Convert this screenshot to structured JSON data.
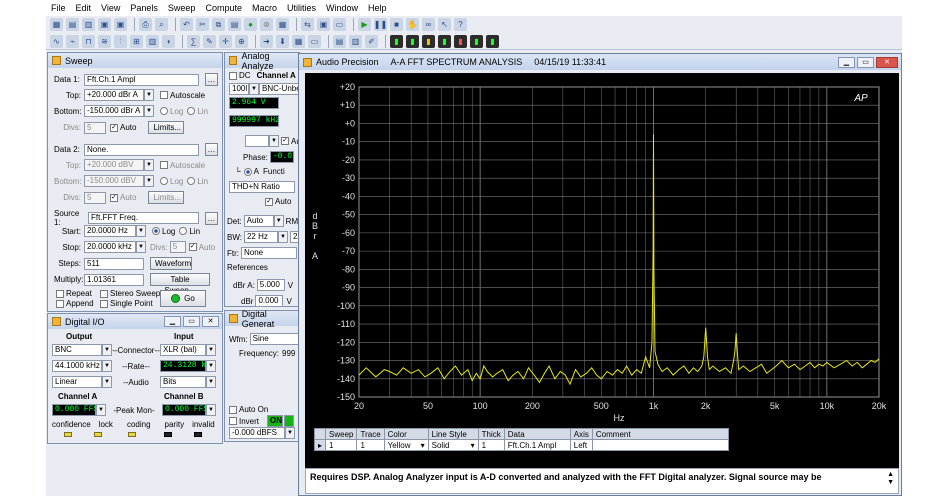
{
  "menu": [
    "File",
    "Edit",
    "View",
    "Panels",
    "Sweep",
    "Compute",
    "Macro",
    "Utilities",
    "Window",
    "Help"
  ],
  "sweep": {
    "title": "Sweep",
    "data1_label": "Data 1:",
    "data1_value": "Fft.Ch.1 Ampl",
    "top_label": "Top:",
    "top_value": "+20.000 dBr A",
    "autoscale_label": "Autoscale",
    "bottom_label": "Bottom:",
    "bottom_value": "-150.000 dBr A",
    "log_label": "Log",
    "lin_label": "Lin",
    "divs_label": "Divs:",
    "divs_value": "5",
    "auto_label": "Auto",
    "limits_label": "Limits...",
    "data2_label": "Data 2:",
    "data2_value": "None.",
    "top2_value": "+20.000 dBV",
    "bottom2_value": "-150.000 dBV",
    "divs2_value": "5",
    "source1_label": "Source 1:",
    "source1_value": "Fft.FFT Freq.",
    "start_label": "Start:",
    "start_value": "20.0000  Hz",
    "stop_label": "Stop:",
    "stop_value": "20.0000 kHz",
    "stop_divs_label": "Divs:",
    "stop_divs_value": "5",
    "steps_label": "Steps:",
    "steps_value": "511",
    "waveform_label": "Waveform",
    "multiply_label": "Multiply:",
    "multiply_value": "1.01361",
    "table_sweep_label": "Table Sweep...",
    "repeat_label": "Repeat",
    "stereo_label": "Stereo Sweep",
    "append_label": "Append",
    "single_label": "Single Point",
    "go_label": "Go"
  },
  "digital_io": {
    "title": "Digital I/O",
    "output_label": "Output",
    "input_label": "Input",
    "out_format": "BNC",
    "connector_label": "--Connector--",
    "in_format": "XLR (bal)",
    "out_rate": "44.1000 kHz",
    "rate_label": "--Rate--",
    "in_rate": "24.3128 kHz",
    "out_audio": "Linear",
    "audio_label": "--Audio",
    "in_audio": "Bits",
    "cha_label": "Channel A",
    "chb_label": "Channel B",
    "cha_value": "0.000   FFS",
    "peak_label": "-Peak Mon-",
    "chb_value": "0.000   FFS",
    "leds": [
      "confidence",
      "lock",
      "coding",
      "parity",
      "invalid"
    ]
  },
  "analog": {
    "title": "Analog Analyze",
    "dc_label": "DC",
    "channel_label": "Channel A",
    "range_value": "100l",
    "coupling_value": "BNC-Unbe",
    "level_value": "2.964   V",
    "freq_value": "999997  kHz",
    "au_label": "Au",
    "phase_label": "Phase:",
    "phase_value": "-0.01",
    "a_label": "A",
    "func_label": "Functi",
    "thd_value": "THD+N Ratio",
    "auto_label": "Auto",
    "det_label": "Det:",
    "det_value": "Auto",
    "rms_value": "RMS",
    "bw_label": "BW:",
    "bw_value": "22 Hz",
    "bw2_value": "22 k",
    "ftr_label": "Ftr:",
    "ftr_value": "None",
    "references_label": "References",
    "dbra_label": "dBr A:",
    "dbra_value": "5.000",
    "dbra_unit": "V",
    "dbr_label": "dBr",
    "dbr_value": "0.000",
    "dbr_unit": "V"
  },
  "digital_gen": {
    "title": "Digital Generat",
    "wfm_label": "Wfm:",
    "wfm_value": "Sine",
    "freq_label": "Frequency:",
    "freq_value": "999",
    "autoon_label": "Auto On",
    "invert_label": "Invert",
    "on_label": "ON",
    "level_value": "-0.000  dBFS"
  },
  "fft_window": {
    "app_label": "Audio Precision",
    "title": "A-A FFT SPECTRUM ANALYSIS",
    "date": "04/15/19 11:33:41",
    "logo": "AP",
    "status": "Requires DSP.  Analog Analyzer input is A-D converted and analyzed with the FFT Digital analyzer.  Signal source may be"
  },
  "trace_table": {
    "headers": [
      "Sweep",
      "Trace",
      "Color",
      "Line Style",
      "Thick",
      "Data",
      "Axis",
      "Comment"
    ],
    "row": [
      "1",
      "1",
      "Yellow",
      "Solid",
      "1",
      "Fft.Ch.1 Ampl",
      "Left",
      ""
    ]
  },
  "chart_data": {
    "type": "line",
    "xlabel": "Hz",
    "ylabel": "d B r  A",
    "xscale": "log",
    "xlim": [
      20,
      20000
    ],
    "ylim": [
      -150,
      20
    ],
    "x_ticks": [
      "20",
      "50",
      "100",
      "200",
      "500",
      "1k",
      "2k",
      "5k",
      "10k",
      "20k"
    ],
    "y_ticks": [
      "+20",
      "+10",
      "+0",
      "-10",
      "-20",
      "-30",
      "-40",
      "-50",
      "-60",
      "-70",
      "-80",
      "-90",
      "-100",
      "-110",
      "-120",
      "-130",
      "-140",
      "-150"
    ],
    "grid": true,
    "colors": {
      "background": "#000000",
      "grid": "#7a7a7a",
      "trace": "#e6e61a"
    },
    "series": [
      {
        "color": "#e6e61a",
        "x": [
          20,
          22,
          25,
          28,
          30,
          33,
          36,
          40,
          44,
          48,
          52,
          57,
          62,
          67,
          72,
          78,
          85,
          90,
          95,
          100,
          105,
          110,
          118,
          125,
          135,
          145,
          155,
          165,
          178,
          190,
          205,
          220,
          235,
          250,
          270,
          290,
          310,
          330,
          355,
          380,
          410,
          440,
          470,
          500,
          540,
          580,
          620,
          660,
          700,
          750,
          800,
          850,
          900,
          950,
          980,
          995,
          1000,
          1005,
          1020,
          1060,
          1120,
          1200,
          1300,
          1400,
          1500,
          1600,
          1700,
          1800,
          1900,
          1950,
          2000,
          2050,
          2100,
          2200,
          2400,
          2600,
          2800,
          2900,
          2950,
          3000,
          3050,
          3100,
          3300,
          3600,
          3900,
          4200,
          4500,
          4800,
          5100,
          5500,
          6000,
          6500,
          7000,
          7500,
          8000,
          8500,
          9000,
          9500,
          10000,
          11000,
          12000,
          13000,
          14000,
          15000,
          16000,
          17000,
          18000,
          19000,
          20000
        ],
        "y": [
          -138,
          -134,
          -139,
          -135,
          -136,
          -138,
          -134,
          -137,
          -135,
          -139,
          -137,
          -134,
          -140,
          -136,
          -133,
          -138,
          -135,
          -141,
          -137,
          -140,
          -133,
          -136,
          -139,
          -137,
          -135,
          -141,
          -138,
          -136,
          -140,
          -134,
          -138,
          -142,
          -137,
          -133,
          -140,
          -136,
          -138,
          -143,
          -135,
          -139,
          -137,
          -134,
          -138,
          -140,
          -136,
          -138,
          -135,
          -137,
          -133,
          -138,
          -135,
          -137,
          -128,
          -134,
          -120,
          -70,
          -6,
          -80,
          -125,
          -132,
          -136,
          -134,
          -138,
          -135,
          -133,
          -137,
          -134,
          -136,
          -133,
          -128,
          -112,
          -128,
          -135,
          -133,
          -136,
          -134,
          -137,
          -130,
          -125,
          -115,
          -126,
          -135,
          -133,
          -136,
          -134,
          -132,
          -137,
          -135,
          -133,
          -130,
          -134,
          -132,
          -135,
          -133,
          -131,
          -134,
          -132,
          -133,
          -131,
          -134,
          -132,
          -130,
          -133,
          -131,
          -134,
          -132,
          -130,
          -131,
          -129
        ]
      }
    ]
  }
}
